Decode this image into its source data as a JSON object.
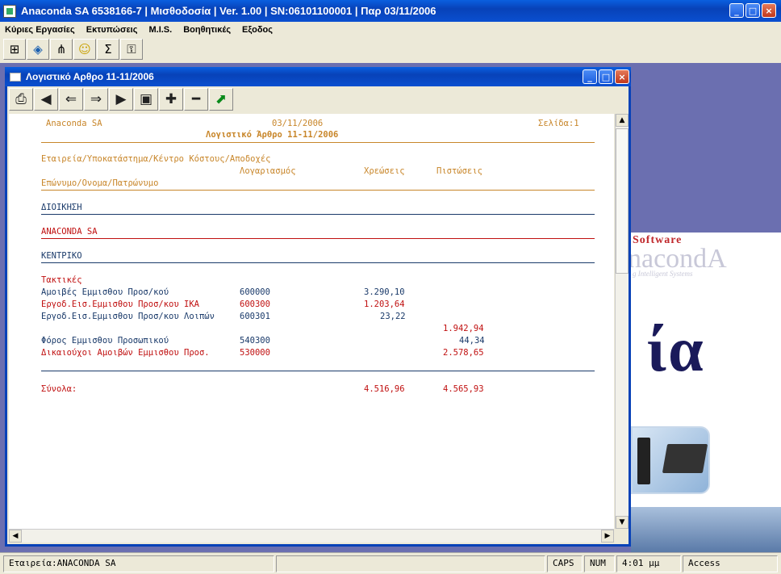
{
  "app": {
    "title": "Anaconda SA 6538166-7 | Μισθοδοσία | Ver. 1.00 | SN:06101100001 | Παρ 03/11/2006",
    "menu": [
      "Κύριες Εργασίες",
      "Εκτυπώσεις",
      "M.I.S.",
      "Βοηθητικές",
      "Εξοδος"
    ],
    "toolbar_icons": [
      "org-chart-icon",
      "network-icon",
      "hierarchy-icon",
      "smiley-icon",
      "sigma-icon",
      "key-icon"
    ]
  },
  "splash": {
    "software": "Software",
    "brand": "nacondA",
    "tagline": "g Intelligent Systems",
    "big": "ία"
  },
  "child": {
    "title": "Λογιστικό Αρθρο 11-11/2006",
    "toolbar_icons": [
      "print-icon",
      "first-page-icon",
      "prev-page-icon",
      "next-page-icon",
      "last-page-icon",
      "save-icon",
      "zoom-in-icon",
      "zoom-out-icon",
      "exit-icon"
    ]
  },
  "report": {
    "company": "Anaconda SA",
    "date": "03/11/2006",
    "page": "Σελίδα:1",
    "title": "Λογιστικό Άρθρο 11-11/2006",
    "header1": "Εταιρεία/Υποκατάστημα/Κέντρο Κόστους/Αποδοχές",
    "col_account": "Λογαριασμός",
    "col_debit": "Χρεώσεις",
    "col_credit": "Πιστώσεις",
    "header2": "Επώνυμο/Ονομα/Πατρώνυμο",
    "group1": "ΔΙΟΙΚΗΣΗ",
    "group2": "ANACONDA SA",
    "group3": "ΚΕΝΤΡΙΚΟ",
    "section": "Τακτικές",
    "rows": [
      {
        "desc": "Αμοιβές Εμμισθου Προσ/κού",
        "account": "600000",
        "debit": "3.290,10",
        "credit": ""
      },
      {
        "desc": "Εργοδ.Εισ.Εμμισθου Προσ/κου ΙΚΑ",
        "account": "600300",
        "debit": "1.203,64",
        "credit": ""
      },
      {
        "desc": "Εργοδ.Εισ.Εμμισθου Προσ/κου Λοιπών",
        "account": "600301",
        "debit": "23,22",
        "credit": ""
      },
      {
        "desc": "",
        "account": "",
        "debit": "",
        "credit": "1.942,94"
      },
      {
        "desc": "Φόρος Εμμισθου Προσωπικού",
        "account": "540300",
        "debit": "",
        "credit": "44,34"
      },
      {
        "desc": "Δικαιούχοι Αμοιβών Εμμισθου Προσ.",
        "account": "530000",
        "debit": "",
        "credit": "2.578,65"
      }
    ],
    "totals_label": "Σύνολα:",
    "totals_debit": "4.516,96",
    "totals_credit": "4.565,93"
  },
  "status": {
    "company": "Εταιρεία:ANACONDA SA",
    "caps": "CAPS",
    "num": "NUM",
    "time": "4:01 μμ",
    "db": "Access"
  }
}
